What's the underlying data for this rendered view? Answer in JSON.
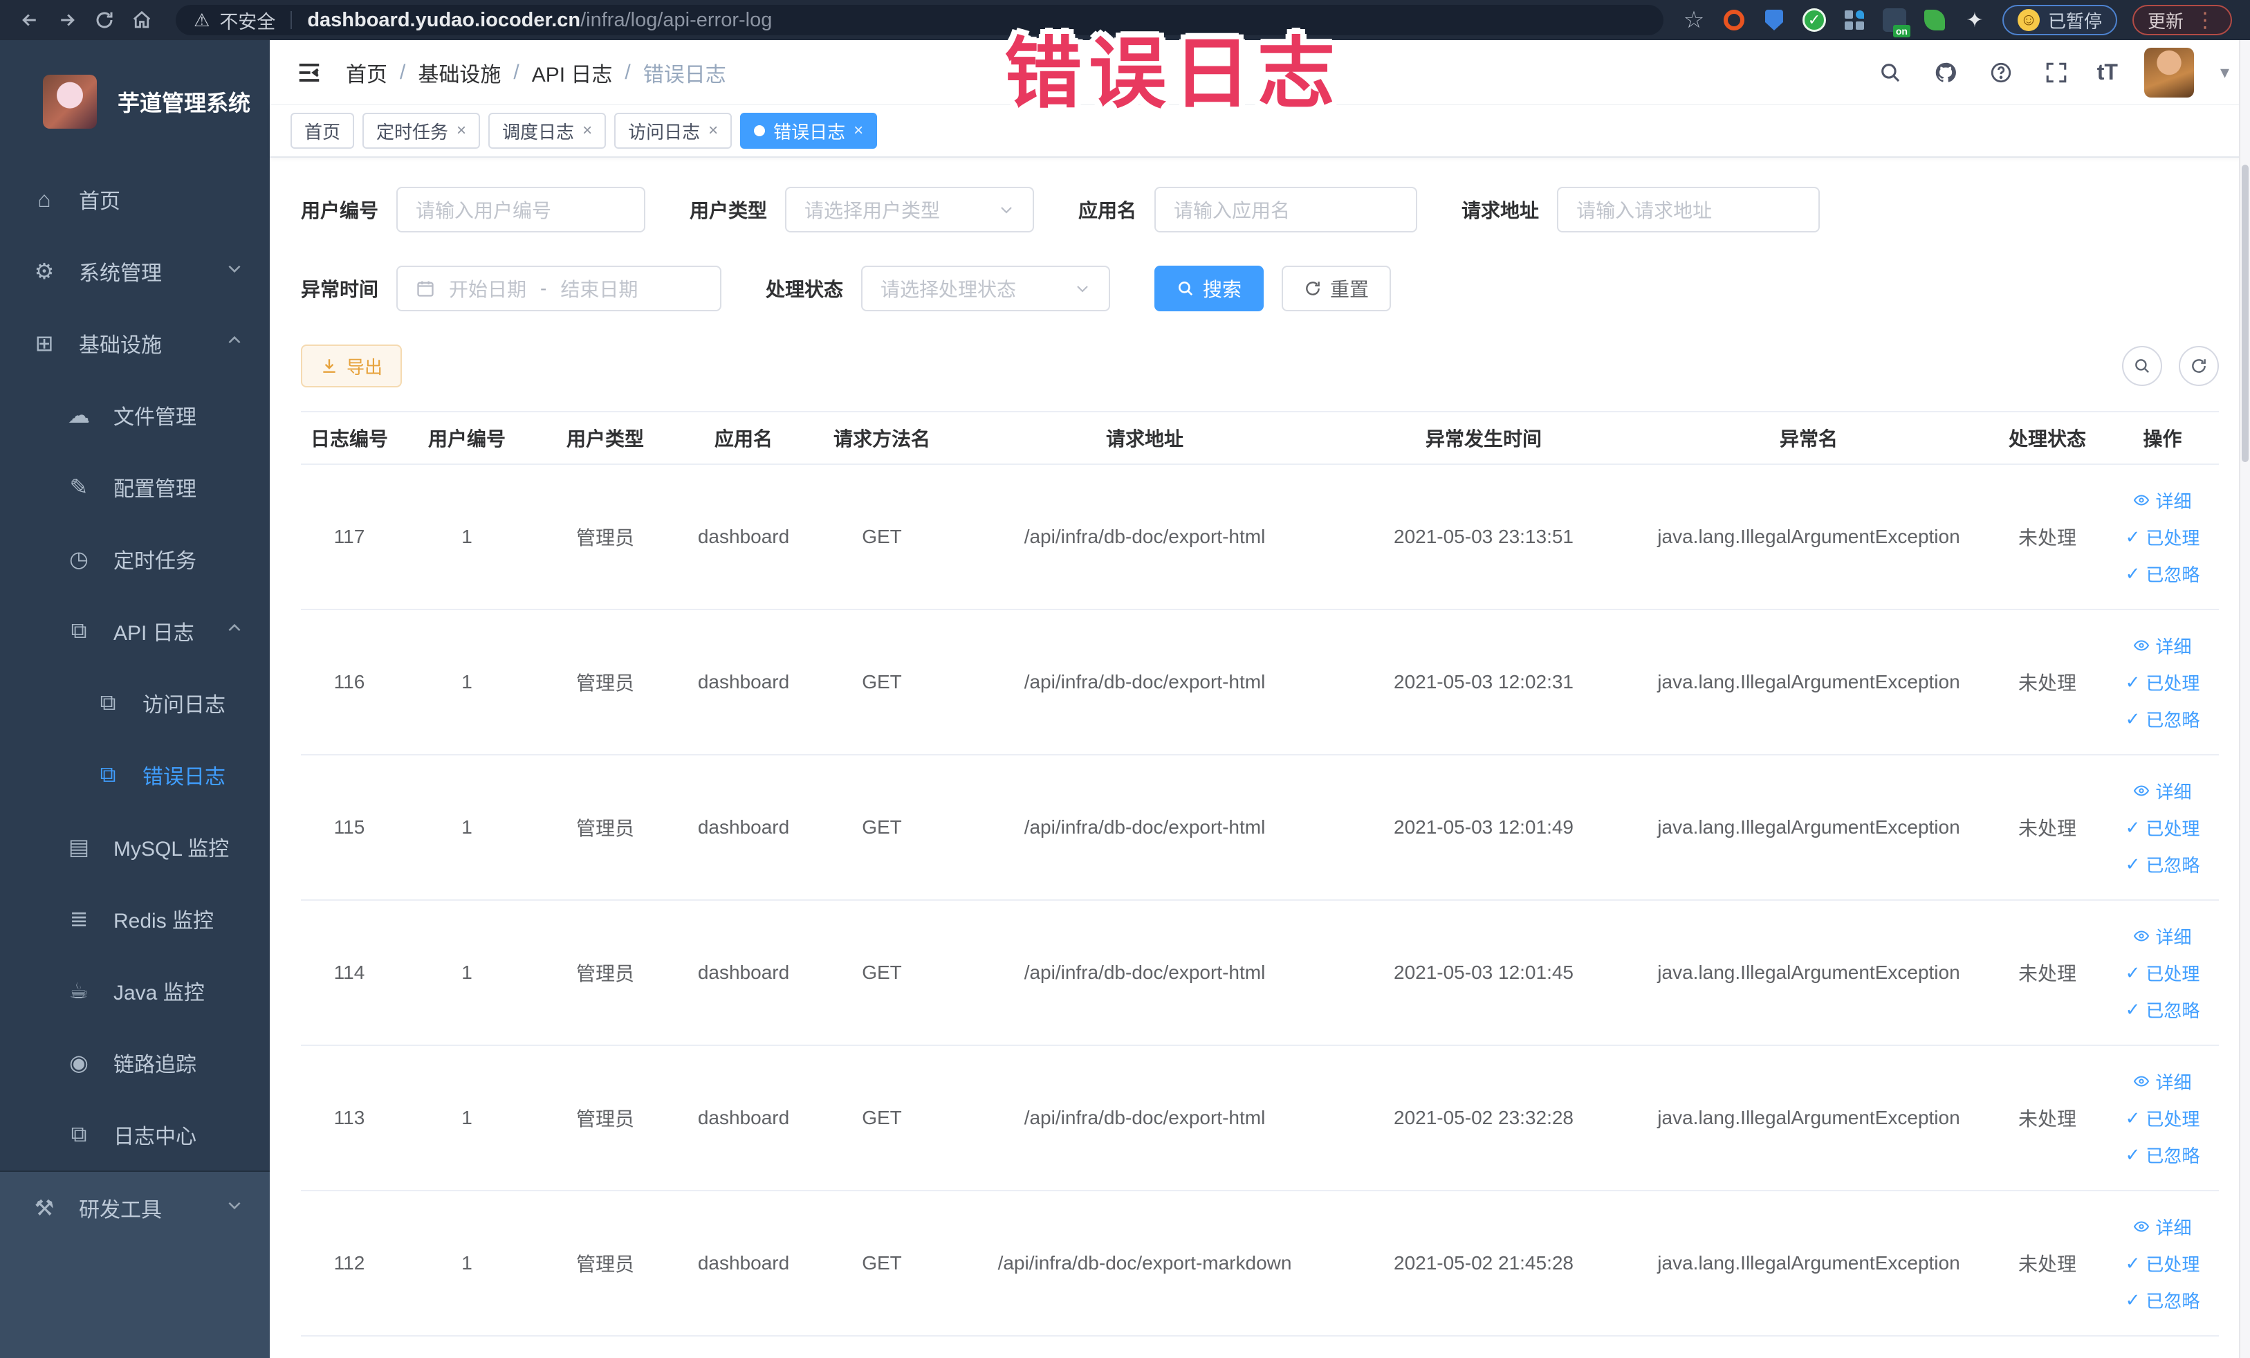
{
  "browser": {
    "security_label": "不安全",
    "url_domain": "dashboard.yudao.iocoder.cn",
    "url_path": "/infra/log/api-error-log",
    "paused_label": "已暂停",
    "update_label": "更新"
  },
  "watermark": {
    "text": "错误日志",
    "color": "#e8395f"
  },
  "sidebar": {
    "app_title": "芋道管理系统",
    "items": [
      {
        "label": "首页",
        "icon": "home-icon"
      },
      {
        "label": "系统管理",
        "icon": "gear-icon",
        "arrow": "down"
      },
      {
        "label": "基础设施",
        "icon": "infrastructure-icon",
        "arrow": "up"
      },
      {
        "label": "文件管理",
        "icon": "file-manage-icon"
      },
      {
        "label": "配置管理",
        "icon": "config-manage-icon"
      },
      {
        "label": "定时任务",
        "icon": "scheduled-job-icon"
      },
      {
        "label": "API 日志",
        "icon": "api-log-icon",
        "arrow": "up"
      },
      {
        "label": "访问日志",
        "icon": "access-log-icon"
      },
      {
        "label": "错误日志",
        "icon": "error-log-icon",
        "active": true
      },
      {
        "label": "MySQL 监控",
        "icon": "mysql-monitor-icon"
      },
      {
        "label": "Redis 监控",
        "icon": "redis-monitor-icon"
      },
      {
        "label": "Java 监控",
        "icon": "java-monitor-icon"
      },
      {
        "label": "链路追踪",
        "icon": "trace-icon"
      },
      {
        "label": "日志中心",
        "icon": "log-center-icon"
      },
      {
        "label": "研发工具",
        "icon": "devtools-icon",
        "arrow": "down"
      }
    ]
  },
  "header": {
    "breadcrumb": [
      "首页",
      "基础设施",
      "API 日志",
      "错误日志"
    ],
    "separator": "/",
    "font_icon_label": "tT"
  },
  "tabs": [
    {
      "label": "首页",
      "closable": false,
      "active": false
    },
    {
      "label": "定时任务",
      "closable": true,
      "active": false
    },
    {
      "label": "调度日志",
      "closable": true,
      "active": false
    },
    {
      "label": "访问日志",
      "closable": true,
      "active": false
    },
    {
      "label": "错误日志",
      "closable": true,
      "active": true
    }
  ],
  "filters": {
    "user_id": {
      "label": "用户编号",
      "placeholder": "请输入用户编号"
    },
    "user_type": {
      "label": "用户类型",
      "placeholder": "请选择用户类型"
    },
    "app_name": {
      "label": "应用名",
      "placeholder": "请输入应用名"
    },
    "request_url": {
      "label": "请求地址",
      "placeholder": "请输入请求地址"
    },
    "exception_time": {
      "label": "异常时间",
      "start_placeholder": "开始日期",
      "separator": "-",
      "end_placeholder": "结束日期"
    },
    "process_status": {
      "label": "处理状态",
      "placeholder": "请选择处理状态"
    },
    "search_label": "搜索",
    "reset_label": "重置"
  },
  "toolbar": {
    "export_label": "导出"
  },
  "table": {
    "columns": [
      "日志编号",
      "用户编号",
      "用户类型",
      "应用名",
      "请求方法名",
      "请求地址",
      "异常发生时间",
      "异常名",
      "处理状态",
      "操作"
    ],
    "actions": [
      "详细",
      "已处理",
      "已忽略"
    ],
    "rows": [
      {
        "id": "117",
        "user_id": "1",
        "user_type": "管理员",
        "app": "dashboard",
        "method": "GET",
        "url": "/api/infra/db-doc/export-html",
        "time": "2021-05-03 23:13:51",
        "exception": "java.lang.IllegalArgumentException",
        "status": "未处理"
      },
      {
        "id": "116",
        "user_id": "1",
        "user_type": "管理员",
        "app": "dashboard",
        "method": "GET",
        "url": "/api/infra/db-doc/export-html",
        "time": "2021-05-03 12:02:31",
        "exception": "java.lang.IllegalArgumentException",
        "status": "未处理"
      },
      {
        "id": "115",
        "user_id": "1",
        "user_type": "管理员",
        "app": "dashboard",
        "method": "GET",
        "url": "/api/infra/db-doc/export-html",
        "time": "2021-05-03 12:01:49",
        "exception": "java.lang.IllegalArgumentException",
        "status": "未处理"
      },
      {
        "id": "114",
        "user_id": "1",
        "user_type": "管理员",
        "app": "dashboard",
        "method": "GET",
        "url": "/api/infra/db-doc/export-html",
        "time": "2021-05-03 12:01:45",
        "exception": "java.lang.IllegalArgumentException",
        "status": "未处理"
      },
      {
        "id": "113",
        "user_id": "1",
        "user_type": "管理员",
        "app": "dashboard",
        "method": "GET",
        "url": "/api/infra/db-doc/export-html",
        "time": "2021-05-02 23:32:28",
        "exception": "java.lang.IllegalArgumentException",
        "status": "未处理"
      },
      {
        "id": "112",
        "user_id": "1",
        "user_type": "管理员",
        "app": "dashboard",
        "method": "GET",
        "url": "/api/infra/db-doc/export-markdown",
        "time": "2021-05-02 21:45:28",
        "exception": "java.lang.IllegalArgumentException",
        "status": "未处理"
      }
    ]
  },
  "colors": {
    "accent": "#409eff",
    "warning": "#e6a23c",
    "sidebar_bg": "#2c3c50",
    "sidebar_bg_light": "#3a4d63",
    "annotation": "#e8395f"
  }
}
